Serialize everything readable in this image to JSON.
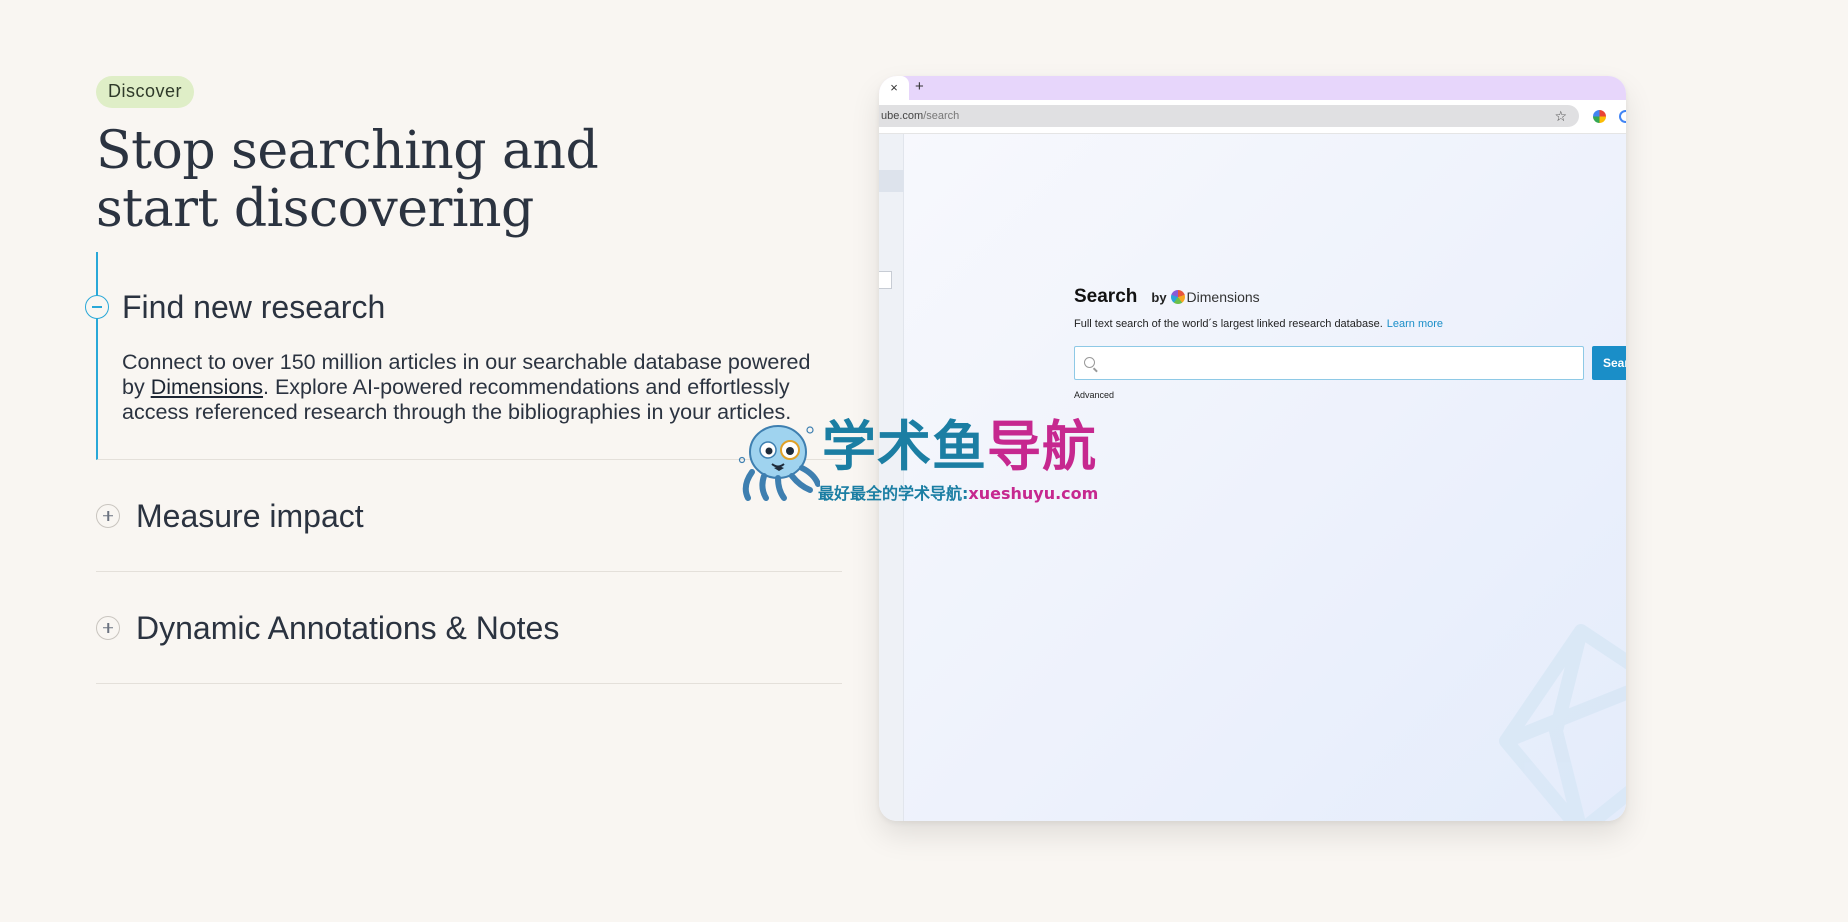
{
  "section": {
    "badge": "Discover",
    "headline": "Stop searching and start discovering"
  },
  "accordion": [
    {
      "title": "Find new research",
      "expanded": true,
      "body_before_link": "Connect to over 150 million articles in our searchable database powered by ",
      "body_link": "Dimensions",
      "body_after_link": ". Explore AI-powered recommendations and effortlessly access referenced research through the bibliographies in your articles."
    },
    {
      "title": "Measure impact",
      "expanded": false
    },
    {
      "title": "Dynamic Annotations & Notes",
      "expanded": false
    }
  ],
  "browser": {
    "tab_close_glyph": "×",
    "new_tab_glyph": "+",
    "url_host": "ube.com",
    "url_path": "/search",
    "star_glyph": "☆",
    "tabbar_color": "#e7d6fb",
    "search": {
      "title": "Search",
      "by": "by",
      "brand": "Dimensions",
      "subtitle": "Full text search of the world´s largest linked research database.",
      "learn_more": "Learn more",
      "input_value": "",
      "button_label": "Sear",
      "advanced": "Advanced",
      "accent": "#1a8ec8"
    }
  },
  "watermark": {
    "title_part1": "学术鱼",
    "title_part2": "导航",
    "subtitle_part1": "最好最全的学术导航:",
    "subtitle_part2": "xueshuyu.com"
  },
  "colors": {
    "background": "#f9f6f2",
    "badge_bg": "#dfeec7",
    "accordion_accent": "#29a8d8",
    "text": "#2b3340"
  }
}
